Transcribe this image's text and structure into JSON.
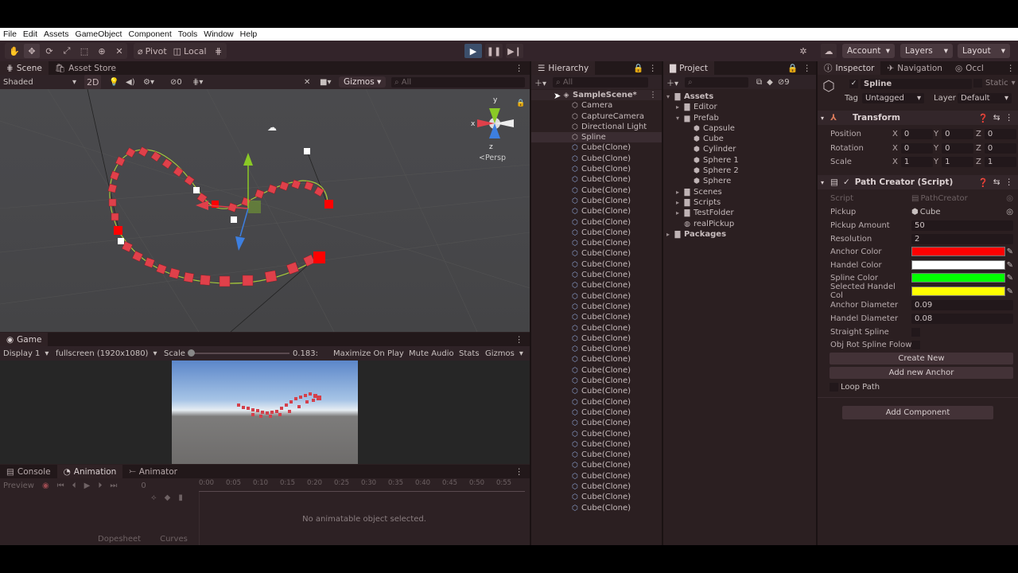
{
  "menu": [
    "File",
    "Edit",
    "Assets",
    "GameObject",
    "Component",
    "Tools",
    "Window",
    "Help"
  ],
  "toolbar": {
    "pivot": "Pivot",
    "local": "Local",
    "account": "Account",
    "layers": "Layers",
    "layout": "Layout"
  },
  "scene": {
    "tabs": [
      "Scene",
      "Asset Store"
    ],
    "shading": "Shaded",
    "mode2d": "2D",
    "hidden_count": "0",
    "gizmos": "Gizmos",
    "search_placeholder": "All",
    "persp": "Persp",
    "axis_y": "y",
    "axis_x": "x",
    "axis_z": "z"
  },
  "game": {
    "tab": "Game",
    "display": "Display 1",
    "resolution": "fullscreen (1920x1080)",
    "scale_label": "Scale",
    "scale_value": "0.183:",
    "maximize": "Maximize On Play",
    "mute": "Mute Audio",
    "stats": "Stats",
    "gizmos": "Gizmos"
  },
  "animation": {
    "tabs": [
      "Console",
      "Animation",
      "Animator"
    ],
    "preview": "Preview",
    "frame": "0",
    "ticks": [
      "0:00",
      "0:05",
      "0:10",
      "0:15",
      "0:20",
      "0:25",
      "0:30",
      "0:35",
      "0:40",
      "0:45",
      "0:50",
      "0:55"
    ],
    "empty_message": "No animatable object selected.",
    "dopesheet": "Dopesheet",
    "curves": "Curves"
  },
  "hierarchy": {
    "tab": "Hierarchy",
    "search_placeholder": "All",
    "scene_name": "SampleScene*",
    "items": [
      "Camera",
      "CaptureCamera",
      "Directional Light",
      "Spline"
    ],
    "clone_label": "Cube(Clone)",
    "clone_count": 35
  },
  "project": {
    "tab": "Project",
    "hidden_count": "9",
    "assets": "Assets",
    "editor": "Editor",
    "prefab": "Prefab",
    "prefab_items": [
      "Capsule",
      "Cube",
      "Cylinder",
      "Sphere 1",
      "Sphere 2",
      "Sphere"
    ],
    "folders": [
      "Scenes",
      "Scripts",
      "TestFolder"
    ],
    "real_pickup": "realPickup",
    "packages": "Packages"
  },
  "inspector": {
    "tabs": [
      "Inspector",
      "Navigation",
      "Occl"
    ],
    "object_name": "Spline",
    "static_label": "Static",
    "tag_label": "Tag",
    "tag_value": "Untagged",
    "layer_label": "Layer",
    "layer_value": "Default",
    "transform": {
      "title": "Transform",
      "position_label": "Position",
      "rotation_label": "Rotation",
      "scale_label": "Scale",
      "position": [
        "0",
        "0",
        "0"
      ],
      "rotation": [
        "0",
        "0",
        "0"
      ],
      "scale": [
        "1",
        "1",
        "1"
      ]
    },
    "path_creator": {
      "title": "Path Creator (Script)",
      "script_label": "Script",
      "script_value": "PathCreator",
      "pickup_label": "Pickup",
      "pickup_value": "Cube",
      "pickup_amount_label": "Pickup Amount",
      "pickup_amount": "50",
      "resolution_label": "Resolution",
      "resolution": "2",
      "anchor_color_label": "Anchor Color",
      "handel_color_label": "Handel Color",
      "spline_color_label": "Spline Color",
      "selected_handel_label": "Selected Handel Col",
      "anchor_diameter_label": "Anchor Diameter",
      "anchor_diameter": "0.09",
      "handel_diameter_label": "Handel Diameter",
      "handel_diameter": "0.08",
      "straight_spline_label": "Straight Spline",
      "obj_rot_label": "Obj Rot Spline Folow",
      "create_new": "Create New",
      "add_anchor": "Add new Anchor",
      "loop_path": "Loop Path"
    },
    "add_component": "Add Component",
    "colors": {
      "anchor": "#ff0000",
      "handel": "#ffffff",
      "spline": "#00ff00",
      "selected_handel": "#ffff00"
    }
  }
}
